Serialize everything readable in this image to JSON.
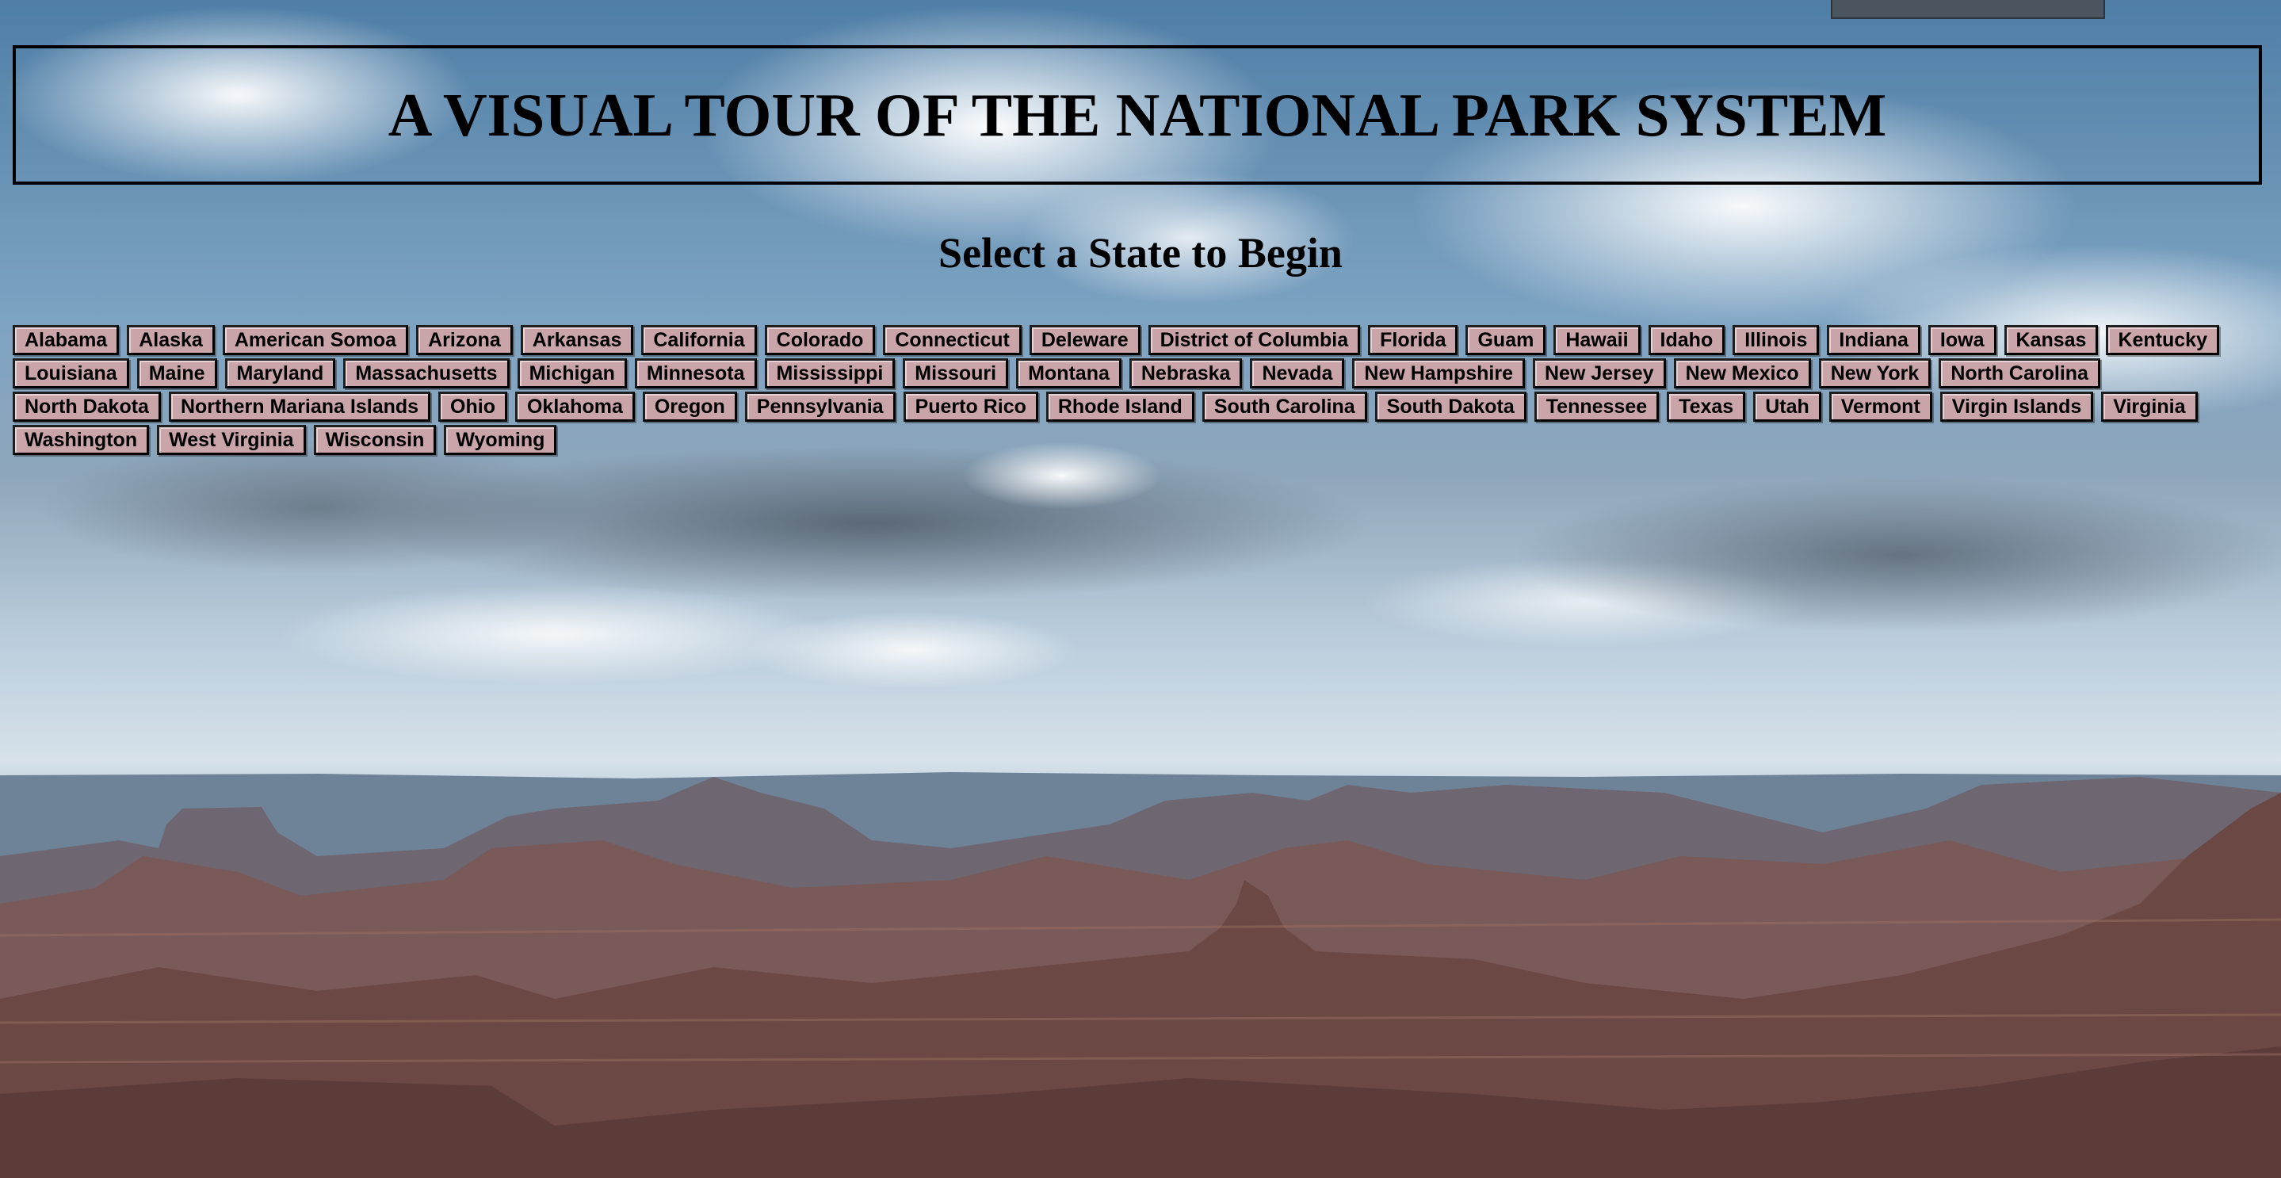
{
  "page": {
    "title": "A VISUAL TOUR OF THE NATIONAL PARK SYSTEM",
    "subtitle": "Select a State to Begin"
  },
  "colors": {
    "button_bg": "#c9a4a9",
    "button_border": "#1e1e1e",
    "text": "#000000",
    "sky": "#4f7ea6",
    "canyon": "#7a4a44"
  },
  "states": [
    "Alabama",
    "Alaska",
    "American Somoa",
    "Arizona",
    "Arkansas",
    "California",
    "Colorado",
    "Connecticut",
    "Deleware",
    "District of Columbia",
    "Florida",
    "Guam",
    "Hawaii",
    "Idaho",
    "Illinois",
    "Indiana",
    "Iowa",
    "Kansas",
    "Kentucky",
    "Louisiana",
    "Maine",
    "Maryland",
    "Massachusetts",
    "Michigan",
    "Minnesota",
    "Mississippi",
    "Missouri",
    "Montana",
    "Nebraska",
    "Nevada",
    "New Hampshire",
    "New Jersey",
    "New Mexico",
    "New York",
    "North Carolina",
    "North Dakota",
    "Northern Mariana Islands",
    "Ohio",
    "Oklahoma",
    "Oregon",
    "Pennsylvania",
    "Puerto Rico",
    "Rhode Island",
    "South Carolina",
    "South Dakota",
    "Tennessee",
    "Texas",
    "Utah",
    "Vermont",
    "Virgin Islands",
    "Virginia",
    "Washington",
    "West Virginia",
    "Wisconsin",
    "Wyoming"
  ]
}
